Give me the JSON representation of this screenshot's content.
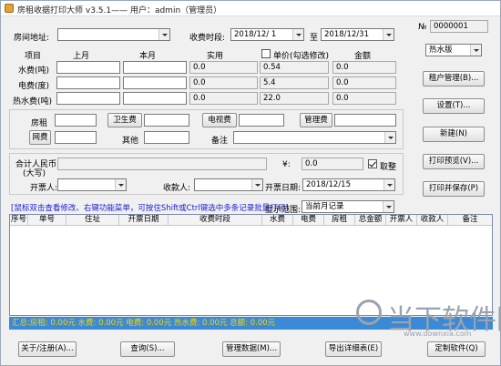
{
  "window": {
    "title": "房租收据打印大师 v3.5.1—— 用户：admin（管理员）"
  },
  "header": {
    "room_address_label": "房间地址:",
    "room_address_value": "",
    "period_label": "收费时段:",
    "period_start": "2018/12/ 1",
    "period_to": "至",
    "period_end": "2018/12/31",
    "no_label": "№",
    "no_value": "0000001",
    "meter_select": "热水版"
  },
  "utilities": {
    "col_item": "项目",
    "col_last": "上月",
    "col_this": "本月",
    "col_actual": "实用",
    "col_price": "单价(勾选修改)",
    "col_amount": "金额",
    "rows": [
      {
        "label": "水费(吨)",
        "last": "",
        "this": "",
        "actual": "0.0",
        "price": "0.54",
        "amount": "0.0"
      },
      {
        "label": "电费(度)",
        "last": "",
        "this": "",
        "actual": "0.0",
        "price": "5.4",
        "amount": "0.0"
      },
      {
        "label": "热水费(吨)",
        "last": "",
        "this": "",
        "actual": "0.0",
        "price": "22.0",
        "amount": "0.0"
      }
    ]
  },
  "fees": {
    "rent_label": "房租",
    "hygiene_button": "卫生费",
    "tv_button": "电视费",
    "management_button": "管理费",
    "network_button": "网费",
    "other_label": "其他",
    "note_label": "备注"
  },
  "totals": {
    "total_label_1": "合计人民币",
    "total_label_2": "(大写)",
    "total_caps": "",
    "currency_symbol": "¥:",
    "total_value": "0.0",
    "round_label": "取整",
    "issuer_label": "开票人:",
    "payee_label": "收款人:",
    "issue_date_label": "开票日期:",
    "issue_date_value": "2018/12/15"
  },
  "side_buttons": {
    "tenant_mgmt": "租户管理(B)...",
    "settings": "设置(T)...",
    "new": "新建(N)",
    "print_preview": "打印预览(V)...",
    "print_save": "打印并保存(P)"
  },
  "list": {
    "hint": "[鼠标双击查看修改、右键功能菜单，可按住Shift或Ctrl键选中多条记录批量打印]",
    "range_label": "显示范围:",
    "range_value": "当前月记录",
    "columns": [
      "序号",
      "单号",
      "住址",
      "开票日期",
      "收费时段",
      "水费",
      "电费",
      "房租",
      "总金额",
      "开票人",
      "收款人",
      "备注"
    ],
    "rows": []
  },
  "summary": {
    "text": "汇总:房租: 0.00元   水费: 0.00元   电费: 0.00元   热水费: 0.00元   总额: 0.00元"
  },
  "bottom_buttons": {
    "about": "关于/注册(A)...",
    "query": "查询(S)...",
    "data_mgmt": "管理数据(M)...",
    "export": "导出详细表(E)",
    "customize": "定制软件(Q)"
  },
  "watermark": {
    "text": "当下软件园",
    "sub": "www.downxia.com"
  }
}
